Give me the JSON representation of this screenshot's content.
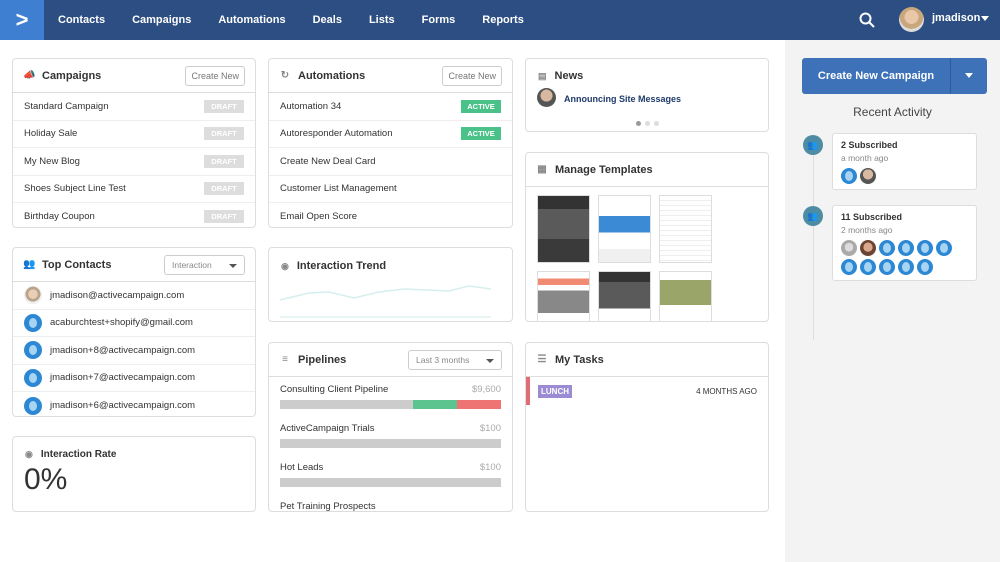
{
  "nav": {
    "logo": ">",
    "items": [
      "Contacts",
      "Campaigns",
      "Automations",
      "Deals",
      "Lists",
      "Forms",
      "Reports"
    ],
    "username": "jmadison"
  },
  "campaigns": {
    "title": "Campaigns",
    "create": "Create New",
    "items": [
      {
        "name": "Standard Campaign",
        "status": "DRAFT"
      },
      {
        "name": "Holiday Sale",
        "status": "DRAFT"
      },
      {
        "name": "My New Blog",
        "status": "DRAFT"
      },
      {
        "name": "Shoes Subject Line Test",
        "status": "DRAFT"
      },
      {
        "name": "Birthday Coupon",
        "status": "DRAFT"
      }
    ]
  },
  "automations": {
    "title": "Automations",
    "create": "Create New",
    "items": [
      {
        "name": "Automation 34",
        "status": "ACTIVE"
      },
      {
        "name": "Autoresponder Automation",
        "status": "ACTIVE"
      },
      {
        "name": "Create New Deal Card",
        "status": ""
      },
      {
        "name": "Customer List Management",
        "status": ""
      },
      {
        "name": "Email Open Score",
        "status": ""
      }
    ]
  },
  "news": {
    "title": "News",
    "headline": "Announcing Site Messages",
    "pages": 3,
    "current_page": 1
  },
  "templates": {
    "title": "Manage Templates",
    "count": 6
  },
  "top_contacts": {
    "title": "Top Contacts",
    "filter": "Interaction",
    "items": [
      "jmadison@activecampaign.com",
      "acaburchtest+shopify@gmail.com",
      "jmadison+8@activecampaign.com",
      "jmadison+7@activecampaign.com",
      "jmadison+6@activecampaign.com"
    ]
  },
  "interaction_trend": {
    "title": "Interaction Trend"
  },
  "interaction_rate": {
    "title": "Interaction Rate",
    "value": "0%"
  },
  "pipelines": {
    "title": "Pipelines",
    "filter": "Last 3 months",
    "items": [
      {
        "name": "Consulting Client Pipeline",
        "value": "$9,600",
        "segments": [
          {
            "fraction": 0.6,
            "color": "#cccccc"
          },
          {
            "fraction": 0.2,
            "color": "#5cc48f"
          },
          {
            "fraction": 0.2,
            "color": "#ee7373"
          }
        ]
      },
      {
        "name": "ActiveCampaign Trials",
        "value": "$100"
      },
      {
        "name": "Hot Leads",
        "value": "$100"
      },
      {
        "name": "Pet Training Prospects",
        "value": ""
      }
    ]
  },
  "tasks": {
    "title": "My Tasks",
    "items": [
      {
        "tag": "LUNCH",
        "time": "4 MONTHS AGO"
      }
    ]
  },
  "right": {
    "create_button": "Create New Campaign",
    "recent_title": "Recent Activity",
    "activities": [
      {
        "title": "2 Subscribed",
        "time": "a month ago"
      },
      {
        "title": "11 Subscribed",
        "time": "2 months ago"
      }
    ]
  }
}
